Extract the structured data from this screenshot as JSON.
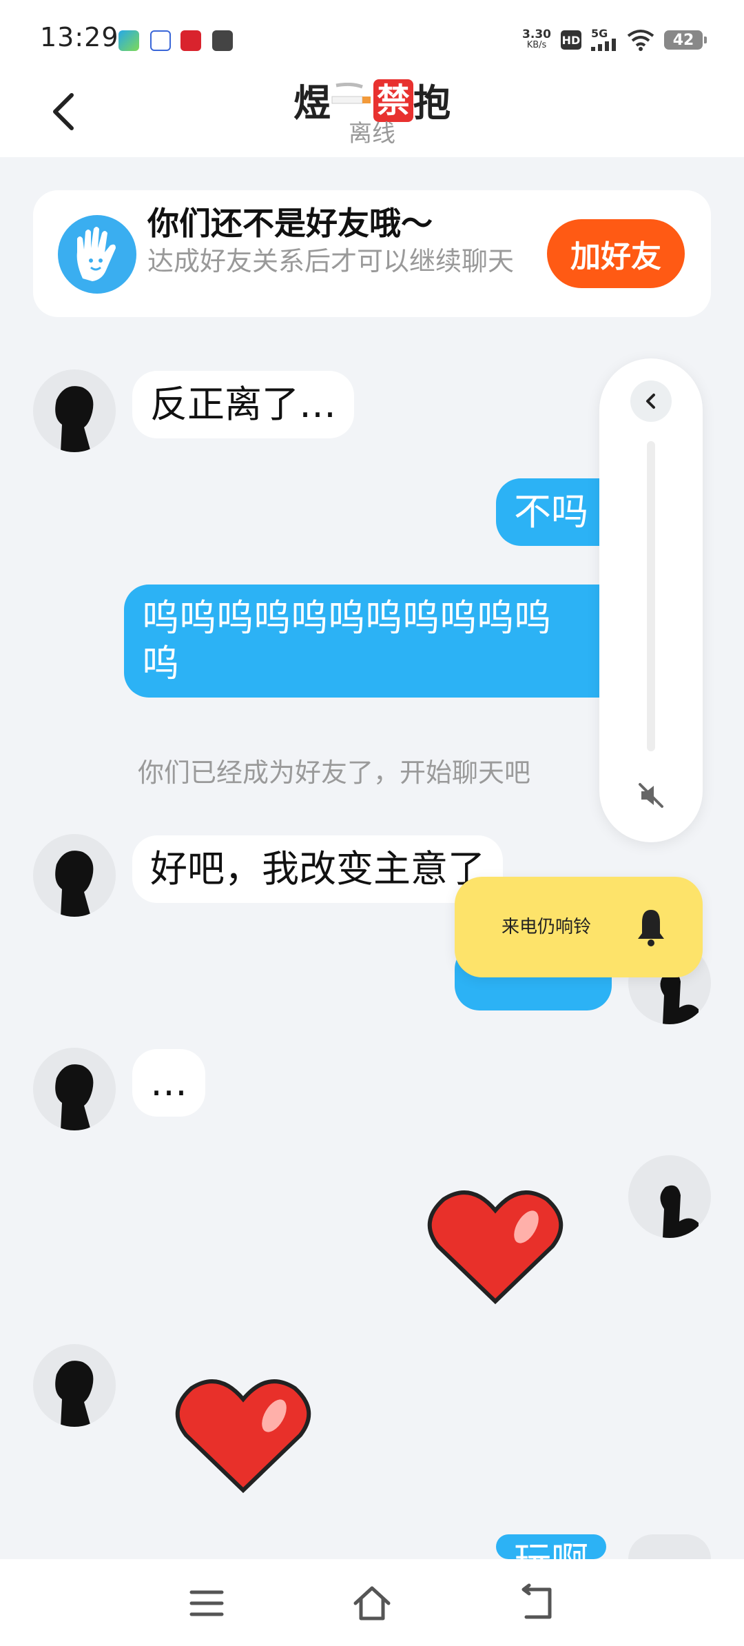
{
  "status_bar": {
    "time": "13:29",
    "net_speed_value": "3.30",
    "net_speed_unit": "KB/s",
    "hd_badge": "HD",
    "network": "5G",
    "battery": "42"
  },
  "header": {
    "title_prefix": "煜",
    "title_ban": "禁",
    "title_suffix": "抱",
    "status": "离线"
  },
  "friend_banner": {
    "title": "你们还不是好友哦～",
    "description": "达成好友关系后才可以继续聊天",
    "add_button": "加好友"
  },
  "messages": [
    {
      "side": "in",
      "text": "反正离了…"
    },
    {
      "side": "out",
      "text": "不吗"
    },
    {
      "side": "out",
      "text": "呜呜呜呜呜呜呜呜呜呜呜呜"
    },
    {
      "side": "system",
      "text": "你们已经成为好友了，开始聊天吧"
    },
    {
      "side": "in",
      "text": "好吧，我改变主意了"
    },
    {
      "side": "in",
      "text": "…"
    },
    {
      "side": "out",
      "text": "玩啊"
    }
  ],
  "ringer_toast": {
    "label": "来电仍响铃"
  },
  "colors": {
    "accent_blue": "#2cb2f5",
    "add_friend_orange": "#ff5a14",
    "toast_yellow": "#fde36a",
    "heart_red": "#e8302a"
  },
  "icons": [
    "back-arrow-icon",
    "hand-icon",
    "chevron-left-icon",
    "volume-mute-icon",
    "bell-icon",
    "heart-sticker",
    "menu-icon",
    "home-icon",
    "return-icon"
  ]
}
